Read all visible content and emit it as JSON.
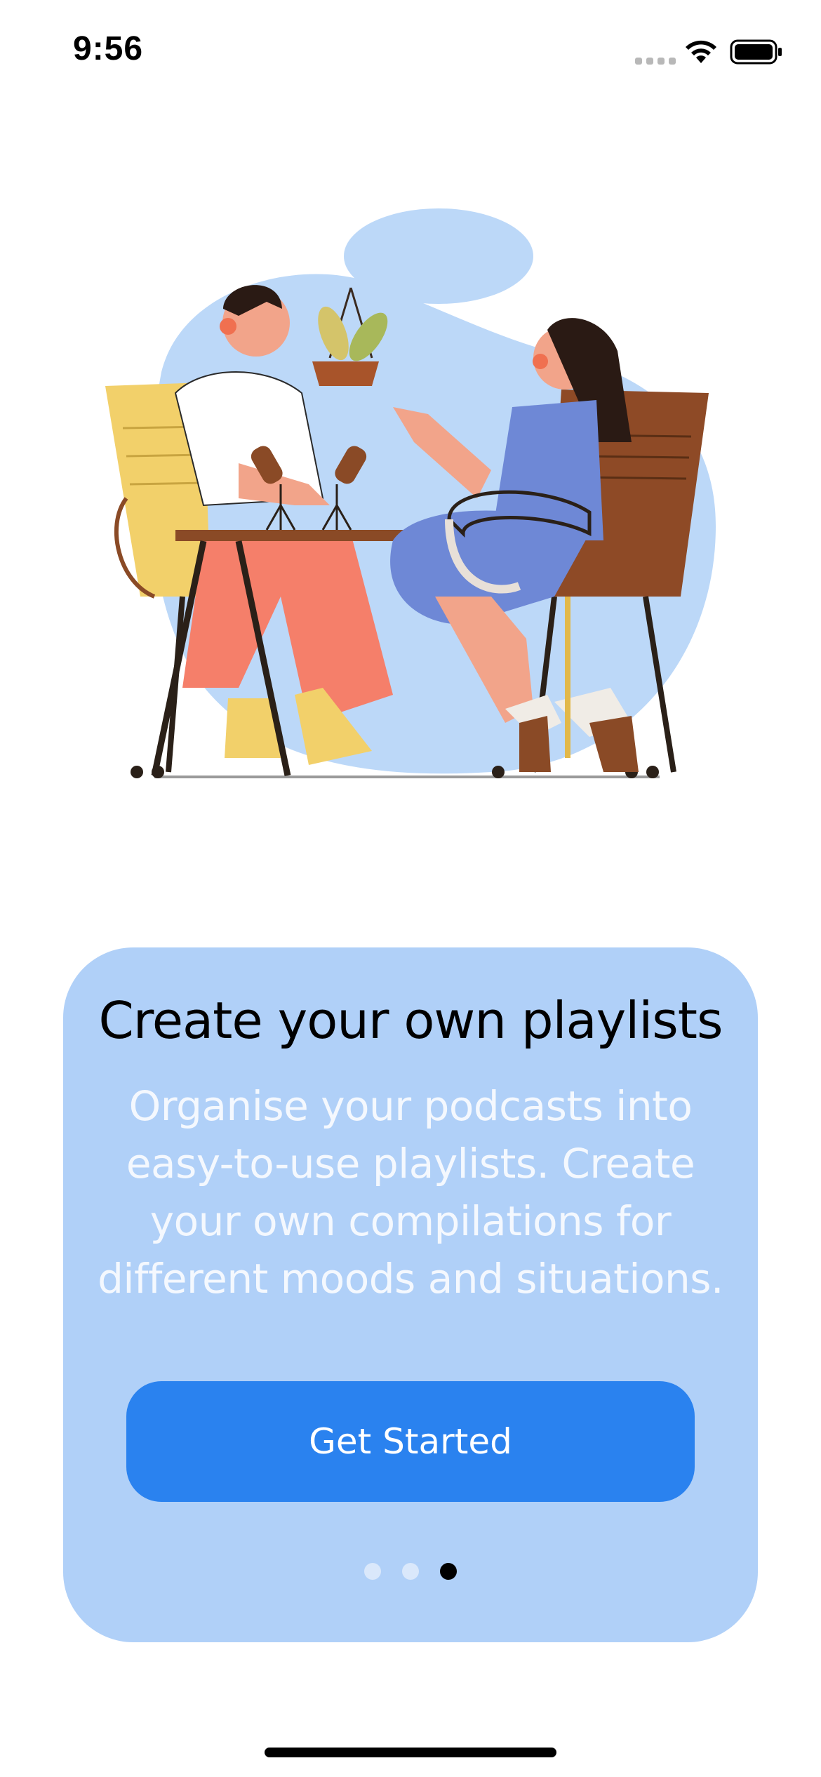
{
  "status_bar": {
    "time": "9:56",
    "icons": [
      "signal-icon",
      "wifi-icon",
      "battery-icon"
    ]
  },
  "illustration": {
    "icon": "podcast-hosts-illustration"
  },
  "onboarding": {
    "title": "Create your own playlists",
    "body": "Organise your podcasts into easy-to-use playlists. Create your own compilations for different moods and situations.",
    "cta_label": "Get Started",
    "page_count": 3,
    "active_page": 3
  },
  "colors": {
    "card_background": "#b0d0f8",
    "button_background": "#2a82ef",
    "button_text": "#ffffff",
    "body_text": "#f4f8fe"
  }
}
